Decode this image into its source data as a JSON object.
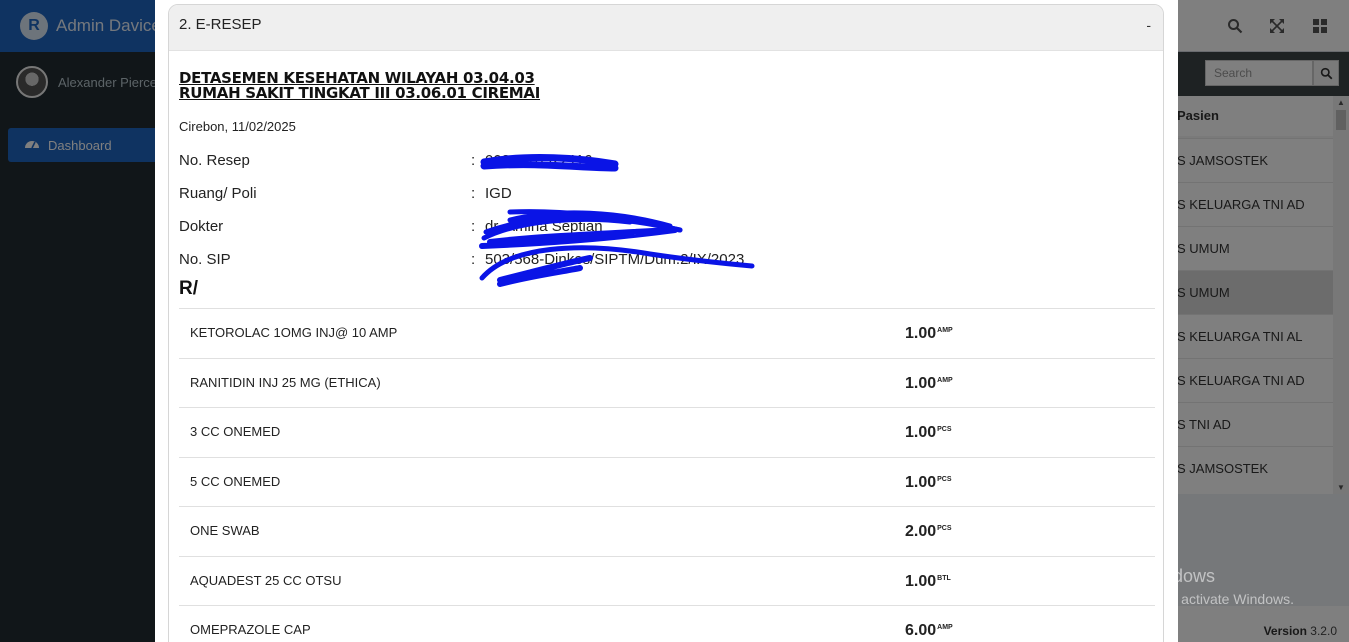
{
  "app": {
    "brand_text": "Admin Davice",
    "brand_logo": "R",
    "version_label": "Version",
    "version_number": "3.2.0"
  },
  "user": {
    "name": "Alexander Pierce"
  },
  "sidebar": {
    "items": [
      {
        "label": "Dashboard",
        "icon": "dashboard-icon"
      }
    ]
  },
  "topbar": {
    "icons": [
      "search-icon",
      "fullscreen-icon",
      "grid-icon"
    ]
  },
  "background_list": {
    "search_placeholder": "Search",
    "column_header": "Pasien",
    "rows": [
      "S JAMSOSTEK",
      "S KELUARGA TNI AD",
      "S UMUM",
      "S UMUM",
      "S KELUARGA TNI AL",
      "S KELUARGA TNI AD",
      "S TNI AD",
      "S JAMSOSTEK"
    ]
  },
  "watermark": {
    "line1": "Activate Windows",
    "line2": "Go to Settings to activate Windows."
  },
  "modal": {
    "panel_title": "2. E-RESEP",
    "collapse_label": "-",
    "doc": {
      "title_line1": "DETASEMEN KESEHATAN WILAYAH 03.04.03",
      "title_line2": "RUMAH SAKIT TINGKAT III 03.06.01 CIREMAI",
      "city_date": "Cirebon, 11/02/2025",
      "fields": [
        {
          "label": "No. Resep",
          "value": "0024070522116"
        },
        {
          "label": "Ruang/ Poli",
          "value": "IGD"
        },
        {
          "label": "Dokter",
          "value": "dr. Amina Septian"
        },
        {
          "label": "No. SIP",
          "value": "503/568-Dinkes/SIPTM/Dum.2/IX/2023"
        }
      ],
      "rx_label": "R/",
      "items": [
        {
          "name": "KETOROLAC 1OMG INJ@ 10 AMP",
          "qty": "1.00",
          "unit": "AMP"
        },
        {
          "name": "RANITIDIN INJ 25 MG (ETHICA)",
          "qty": "1.00",
          "unit": "AMP"
        },
        {
          "name": "3 CC ONEMED",
          "qty": "1.00",
          "unit": "PCS"
        },
        {
          "name": "5 CC ONEMED",
          "qty": "1.00",
          "unit": "PCS"
        },
        {
          "name": "ONE SWAB",
          "qty": "2.00",
          "unit": "PCS"
        },
        {
          "name": "AQUADEST 25 CC OTSU",
          "qty": "1.00",
          "unit": "BTL"
        },
        {
          "name": "OMEPRAZOLE CAP",
          "qty": "6.00",
          "unit": "AMP"
        }
      ]
    }
  }
}
